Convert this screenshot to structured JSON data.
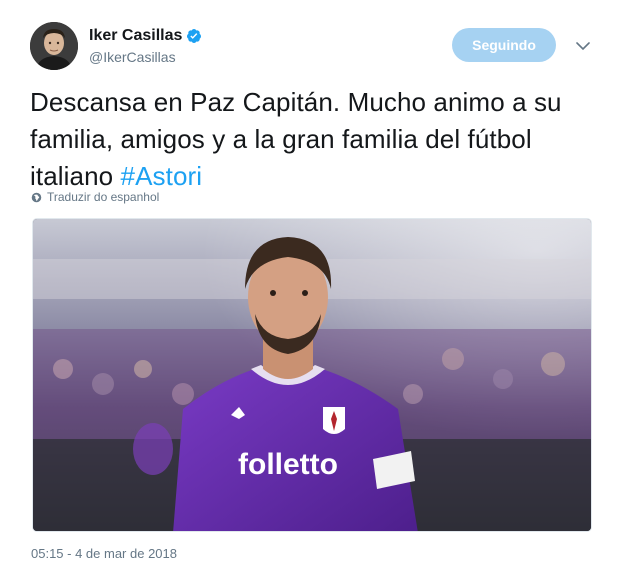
{
  "author": {
    "display_name": "Iker Casillas",
    "handle": "@IkerCasillas",
    "verified": true,
    "avatar_icon": "user-avatar"
  },
  "follow_button": {
    "label": "Seguindo",
    "color": "#a6d2f2"
  },
  "menu_icon": "chevron-down-icon",
  "tweet": {
    "text": "Descansa en Paz Capitán. Mucho animo a su familia, amigos y a la gran familia del fútbol italiano ",
    "hashtag": "#Astori",
    "translate_label": "Traduzir do espanhol",
    "timestamp": "05:15 - 4 de mar de 2018"
  },
  "media": {
    "jersey_text": "folletto",
    "jersey_color": "#6b2fb3"
  },
  "colors": {
    "text": "#14171a",
    "muted": "#657786",
    "link": "#1da1f2",
    "verified": "#1da1f2"
  }
}
